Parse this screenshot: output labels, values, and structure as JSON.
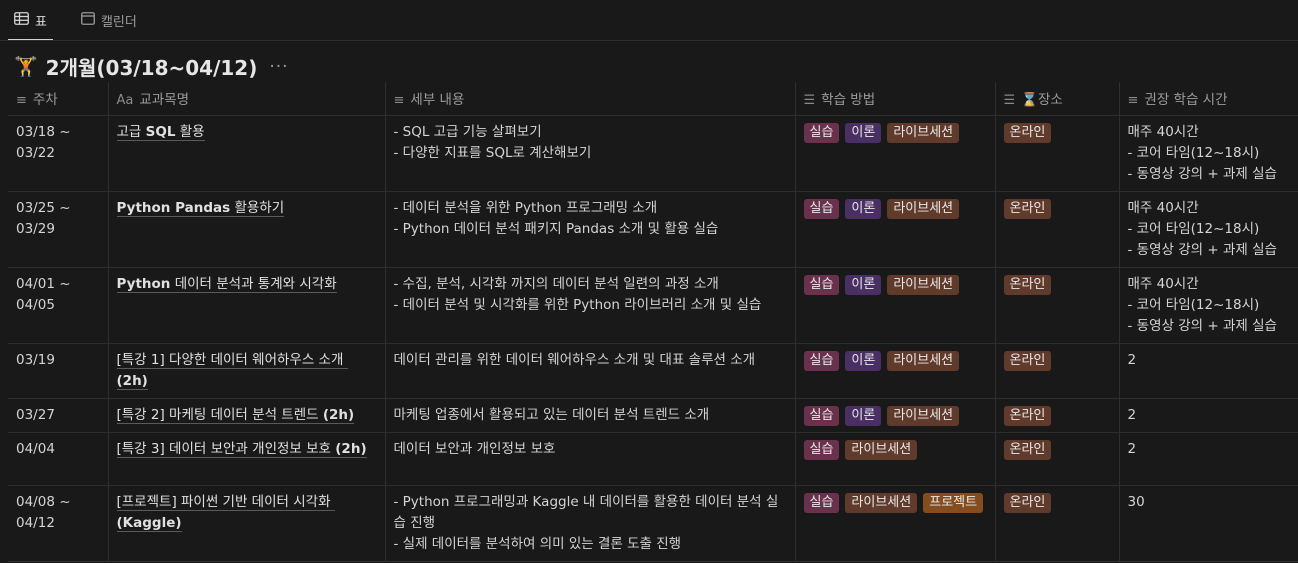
{
  "tabs": [
    {
      "label": "표",
      "icon": "table-icon",
      "active": true
    },
    {
      "label": "캘린더",
      "icon": "calendar-icon",
      "active": false
    }
  ],
  "group": {
    "emoji": "🏋",
    "title": "2개월(03/18~04/12)",
    "more": "···"
  },
  "columns": [
    {
      "label": "주차",
      "icon": "text-lines-icon"
    },
    {
      "label": "교과목명",
      "icon": "title-aa-icon",
      "icon_text": "Aa"
    },
    {
      "label": "세부 내용",
      "icon": "text-lines-icon"
    },
    {
      "label": "학습 방법",
      "icon": "multi-select-icon"
    },
    {
      "label": "장소",
      "icon": "multi-select-icon",
      "prefix": "⌛"
    },
    {
      "label": "권장 학습 시간",
      "icon": "text-lines-icon"
    }
  ],
  "rows": [
    {
      "week": [
        "03/18 ~",
        "03/22"
      ],
      "title_parts": [
        {
          "text": "고급 ",
          "bold": false
        },
        {
          "text": "SQL",
          "bold": true
        },
        {
          "text": " 활용",
          "bold": false
        }
      ],
      "details": [
        "- SQL 고급 기능 살펴보기",
        "- 다양한 지표를 SQL로 계산해보기"
      ],
      "methods": [
        {
          "label": "실습",
          "color": "pink"
        },
        {
          "label": "이론",
          "color": "purple"
        },
        {
          "label": "라이브세션",
          "color": "brown"
        }
      ],
      "place": "온라인",
      "time": [
        "매주 40시간",
        "- 코어 타임(12~18시)",
        "- 동영상 강의 + 과제 실습"
      ]
    },
    {
      "week": [
        "03/25 ~",
        "03/29"
      ],
      "title_parts": [
        {
          "text": "Python Pandas",
          "bold": true
        },
        {
          "text": " 활용하기",
          "bold": false
        }
      ],
      "details": [
        "- 데이터 분석을 위한 Python 프로그래밍 소개",
        "- Python 데이터 분석 패키지 Pandas 소개 및 활용 실습"
      ],
      "methods": [
        {
          "label": "실습",
          "color": "pink"
        },
        {
          "label": "이론",
          "color": "purple"
        },
        {
          "label": "라이브세션",
          "color": "brown"
        }
      ],
      "place": "온라인",
      "time": [
        "매주 40시간",
        "- 코어 타임(12~18시)",
        "- 동영상 강의 + 과제 실습"
      ]
    },
    {
      "week": [
        "04/01 ~",
        "04/05"
      ],
      "title_parts": [
        {
          "text": "Python",
          "bold": true
        },
        {
          "text": " 데이터 분석과 통계와 시각화",
          "bold": false
        }
      ],
      "details": [
        "- 수집, 분석, 시각화 까지의 데이터 분석 일련의 과정 소개",
        "- 데이터 분석 및 시각화를 위한 Python 라이브러리 소개 및 실습"
      ],
      "methods": [
        {
          "label": "실습",
          "color": "pink"
        },
        {
          "label": "이론",
          "color": "purple"
        },
        {
          "label": "라이브세션",
          "color": "brown"
        }
      ],
      "place": "온라인",
      "time": [
        "매주 40시간",
        "- 코어 타임(12~18시)",
        "- 동영상 강의 + 과제 실습"
      ]
    },
    {
      "week": [
        "03/19"
      ],
      "title_parts": [
        {
          "text": "[특강 1] 다양한 데이터 웨어하우스 소개 ",
          "bold": false
        },
        {
          "text": "(2h)",
          "bold": true
        }
      ],
      "details": [
        "데이터 관리를 위한 데이터 웨어하우스 소개 및 대표 솔루션 소개"
      ],
      "methods": [
        {
          "label": "실습",
          "color": "pink"
        },
        {
          "label": "이론",
          "color": "purple"
        },
        {
          "label": "라이브세션",
          "color": "brown"
        }
      ],
      "place": "온라인",
      "time": [
        "2"
      ]
    },
    {
      "week": [
        "03/27"
      ],
      "title_parts": [
        {
          "text": "[특강 2] 마케팅 데이터 분석 트렌드 ",
          "bold": false
        },
        {
          "text": "(2h)",
          "bold": true
        }
      ],
      "details": [
        "마케팅 업종에서 활용되고 있는 데이터 분석 트렌드 소개"
      ],
      "methods": [
        {
          "label": "실습",
          "color": "pink"
        },
        {
          "label": "이론",
          "color": "purple"
        },
        {
          "label": "라이브세션",
          "color": "brown"
        }
      ],
      "place": "온라인",
      "time": [
        "2"
      ]
    },
    {
      "week": [
        "04/04"
      ],
      "title_parts": [
        {
          "text": "[특강 3] 데이터 보안과 개인정보 보호 ",
          "bold": false
        },
        {
          "text": "(2h)",
          "bold": true
        }
      ],
      "details": [
        "데이터 보안과 개인정보 보호"
      ],
      "methods": [
        {
          "label": "실습",
          "color": "pink"
        },
        {
          "label": "라이브세션",
          "color": "brown"
        }
      ],
      "place": "온라인",
      "time": [
        "2"
      ]
    },
    {
      "week": [
        "04/08 ~",
        "04/12"
      ],
      "title_parts": [
        {
          "text": "[프로젝트] 파이썬 기반 데이터 시각화 ",
          "bold": false
        },
        {
          "text": "(Kaggle)",
          "bold": true
        }
      ],
      "details": [
        "- Python 프로그래밍과 Kaggle 내 데이터를 활용한 데이터 분석 실습 진행",
        "- 실제 데이터를 분석하여 의미 있는 결론 도출 진행"
      ],
      "methods": [
        {
          "label": "실습",
          "color": "pink"
        },
        {
          "label": "라이브세션",
          "color": "brown"
        },
        {
          "label": "프로젝트",
          "color": "orange"
        }
      ],
      "place": "온라인",
      "time": [
        "30"
      ]
    }
  ]
}
